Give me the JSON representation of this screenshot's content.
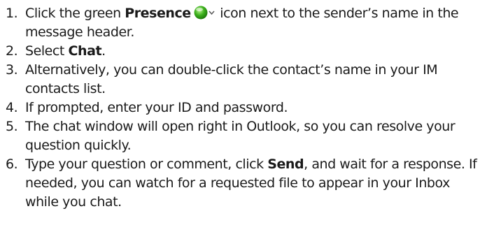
{
  "steps": [
    {
      "number": "1.",
      "text_a": "Click the green ",
      "bold": "Presence",
      "text_b": " icon next to the sender’s name in the message header.",
      "icon": "presence-status-icon"
    },
    {
      "number": "2.",
      "text_a": "Select ",
      "bold": "Chat",
      "text_b": "."
    },
    {
      "number": "3.",
      "text": "Alternatively, you can double-click the contact’s name in your IM contacts list."
    },
    {
      "number": "4.",
      "text": "If prompted, enter your ID and password."
    },
    {
      "number": "5.",
      "text": "The chat window will open right in Outlook, so you can resolve your question quickly."
    },
    {
      "number": "6.",
      "text_a": "Type your question or comment, click ",
      "bold": "Send",
      "text_b": ", and wait for a response. If needed, you can watch for a requested file to appear in your Inbox while you chat."
    }
  ],
  "colors": {
    "presence_green": "#3cb01c",
    "text": "#1a1a1a"
  }
}
